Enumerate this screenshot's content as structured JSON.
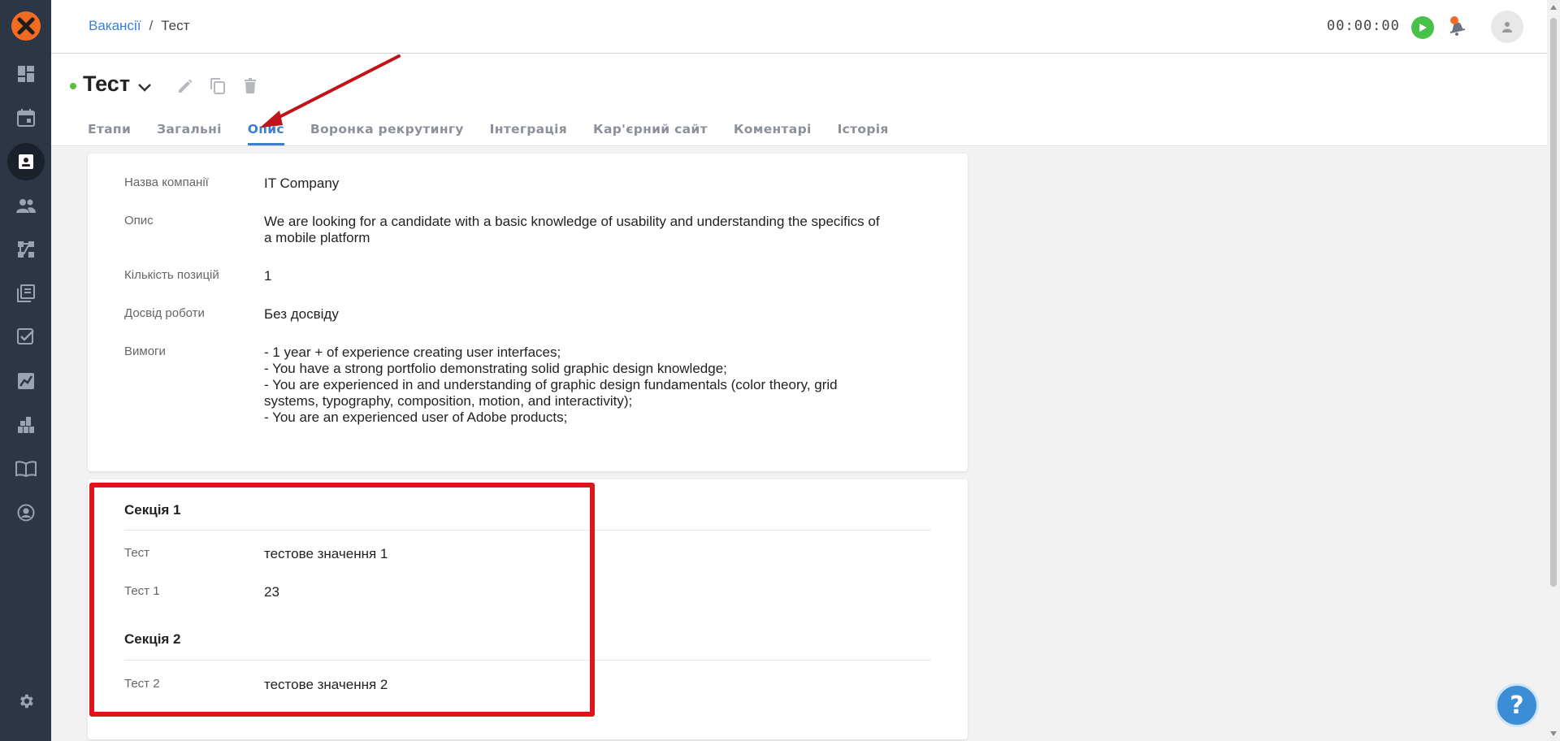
{
  "breadcrumb": {
    "parent": "Вакансії",
    "separator": "/",
    "current": "Тест"
  },
  "timer": {
    "value": "00:00:00"
  },
  "vacancy": {
    "title": "Тест"
  },
  "tabs": [
    {
      "label": "Етапи"
    },
    {
      "label": "Загальні"
    },
    {
      "label": "Опис",
      "active": true
    },
    {
      "label": "Воронка рекрутингу"
    },
    {
      "label": "Інтеграція"
    },
    {
      "label": "Кар'єрний сайт"
    },
    {
      "label": "Коментарі"
    },
    {
      "label": "Історія"
    }
  ],
  "details": {
    "company": {
      "label": "Назва компанії",
      "value": "IT Company"
    },
    "description": {
      "label": "Опис",
      "value": "We are looking for a candidate with a basic knowledge of usability and understanding the specifics of a mobile platform"
    },
    "positions": {
      "label": "Кількість позицій",
      "value": "1"
    },
    "experience": {
      "label": "Досвід роботи",
      "value": "Без досвіду"
    },
    "requirements": {
      "label": "Вимоги",
      "lines": [
        "- 1 year + of experience creating user interfaces;",
        "- You have a strong portfolio demonstrating solid graphic design knowledge;",
        "- You are experienced in and understanding of graphic design fundamentals (color theory, grid systems, typography, composition, motion, and interactivity);",
        "- You are an experienced user of Adobe products;"
      ]
    }
  },
  "sections": [
    {
      "title": "Секція 1",
      "fields": [
        {
          "label": "Тест",
          "value": "тестове значення 1"
        },
        {
          "label": "Тест 1",
          "value": "23"
        }
      ]
    },
    {
      "title": "Секція 2",
      "fields": [
        {
          "label": "Тест 2",
          "value": "тестове значення 2"
        }
      ]
    }
  ],
  "help": {
    "label": "?"
  },
  "colors": {
    "accent": "#3b7fd0",
    "sidebar": "#2d3644",
    "logo": "#f26b21",
    "annotation": "#e0151b",
    "status": "#58c13c"
  }
}
